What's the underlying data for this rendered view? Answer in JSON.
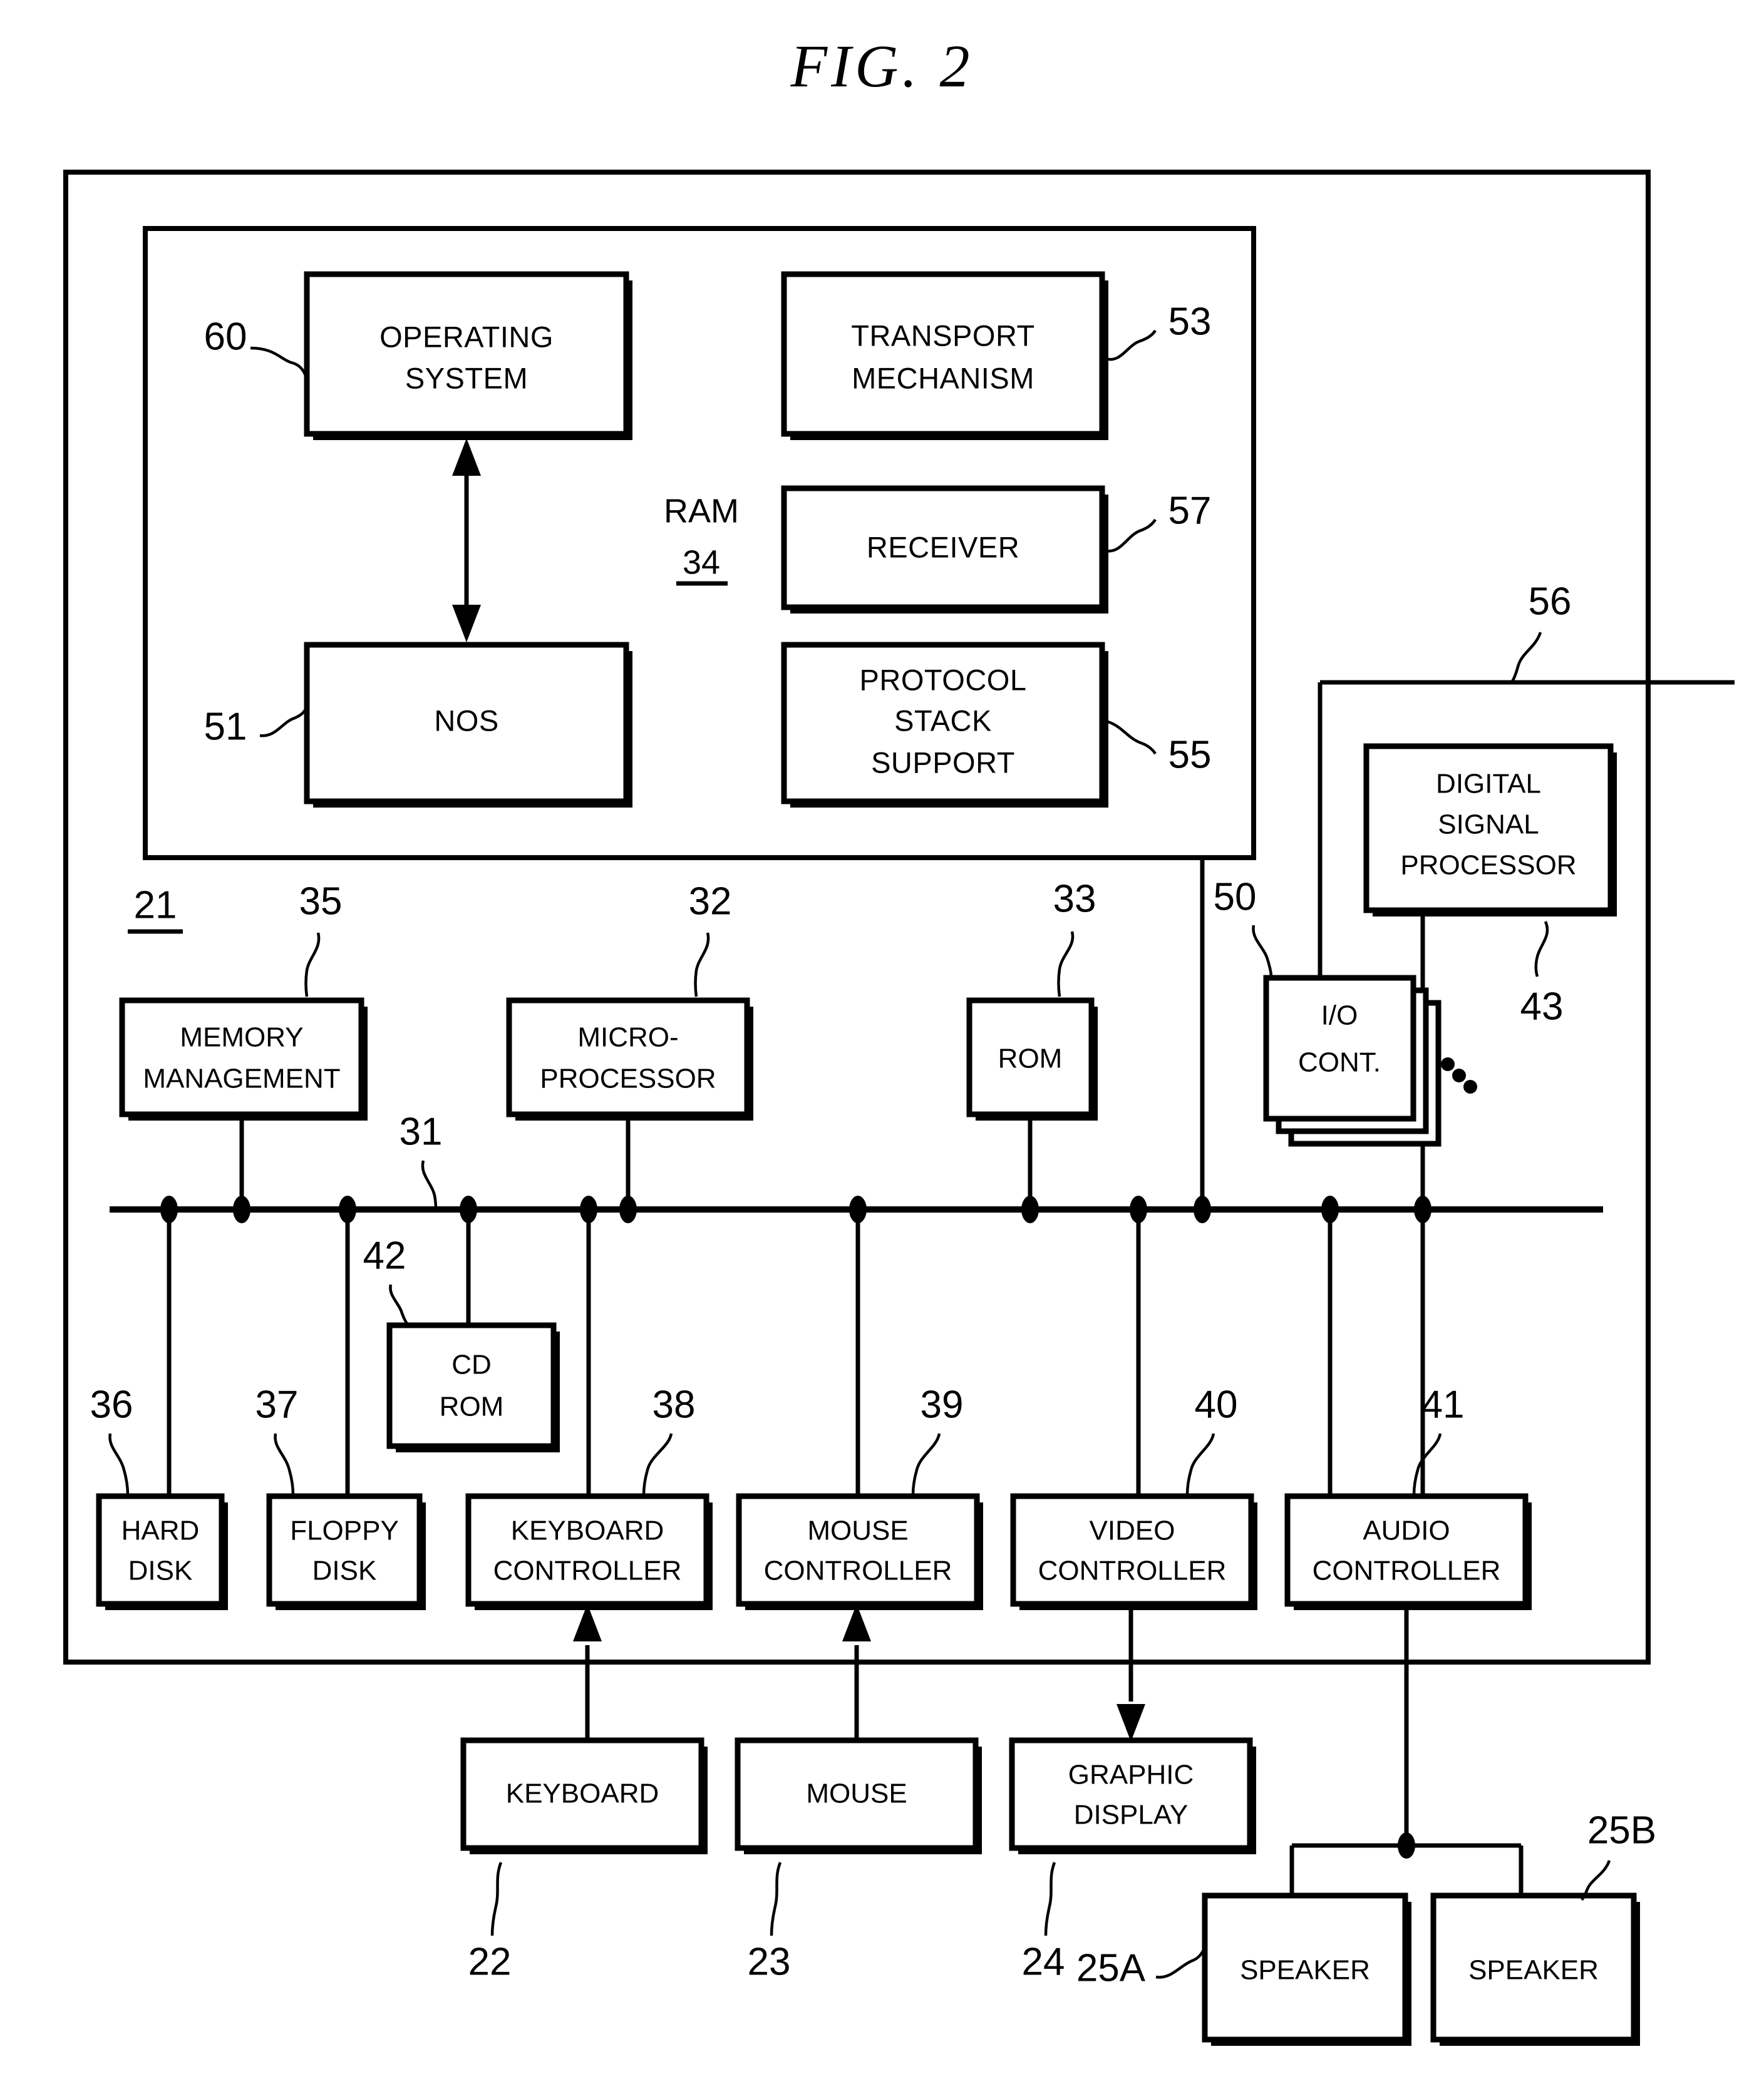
{
  "figure": {
    "title": "FIG.  2"
  },
  "memory": {
    "ram_label": "RAM",
    "ram_ref": "34",
    "blocks": [
      {
        "label_line1": "OPERATING",
        "label_line2": "SYSTEM",
        "ref": "60"
      },
      {
        "label_line1": "NOS",
        "label_line2": "",
        "ref": "51"
      },
      {
        "label_line1": "TRANSPORT",
        "label_line2": "MECHANISM",
        "ref": "53"
      },
      {
        "label_line1": "RECEIVER",
        "label_line2": "",
        "ref": "57"
      },
      {
        "label_line1": "PROTOCOL",
        "label_line2": "STACK",
        "label_line3": "SUPPORT",
        "ref": "55"
      }
    ]
  },
  "system": {
    "system_ref": "21",
    "bus_ref": "31",
    "external_line_ref": "56",
    "dsp": {
      "label_line1": "DIGITAL",
      "label_line2": "SIGNAL",
      "label_line3": "PROCESSOR",
      "ref": "43"
    },
    "io_controller": {
      "label_line1": "I/O",
      "label_line2": "CONT.",
      "ref": "50",
      "ellipsis": "..."
    },
    "upper_blocks": [
      {
        "label_line1": "MEMORY",
        "label_line2": "MANAGEMENT",
        "ref": "35"
      },
      {
        "label_line1": "MICRO-",
        "label_line2": "PROCESSOR",
        "ref": "32"
      },
      {
        "label_line1": "ROM",
        "label_line2": "",
        "ref": "33"
      }
    ],
    "cd_rom": {
      "label_line1": "CD",
      "label_line2": "ROM",
      "ref": "42"
    },
    "lower_blocks": [
      {
        "label_line1": "HARD",
        "label_line2": "DISK",
        "ref": "36"
      },
      {
        "label_line1": "FLOPPY",
        "label_line2": "DISK",
        "ref": "37"
      },
      {
        "label_line1": "KEYBOARD",
        "label_line2": "CONTROLLER",
        "ref": "38"
      },
      {
        "label_line1": "MOUSE",
        "label_line2": "CONTROLLER",
        "ref": "39"
      },
      {
        "label_line1": "VIDEO",
        "label_line2": "CONTROLLER",
        "ref": "40"
      },
      {
        "label_line1": "AUDIO",
        "label_line2": "CONTROLLER",
        "ref": "41"
      }
    ]
  },
  "peripherals": [
    {
      "label": "KEYBOARD",
      "ref": "22"
    },
    {
      "label": "MOUSE",
      "ref": "23"
    },
    {
      "label_line1": "GRAPHIC",
      "label_line2": "DISPLAY",
      "ref": "24"
    },
    {
      "label": "SPEAKER",
      "ref": "25A"
    },
    {
      "label": "SPEAKER",
      "ref": "25B"
    }
  ],
  "colors": {
    "ink": "#000000",
    "paper": "#ffffff"
  }
}
